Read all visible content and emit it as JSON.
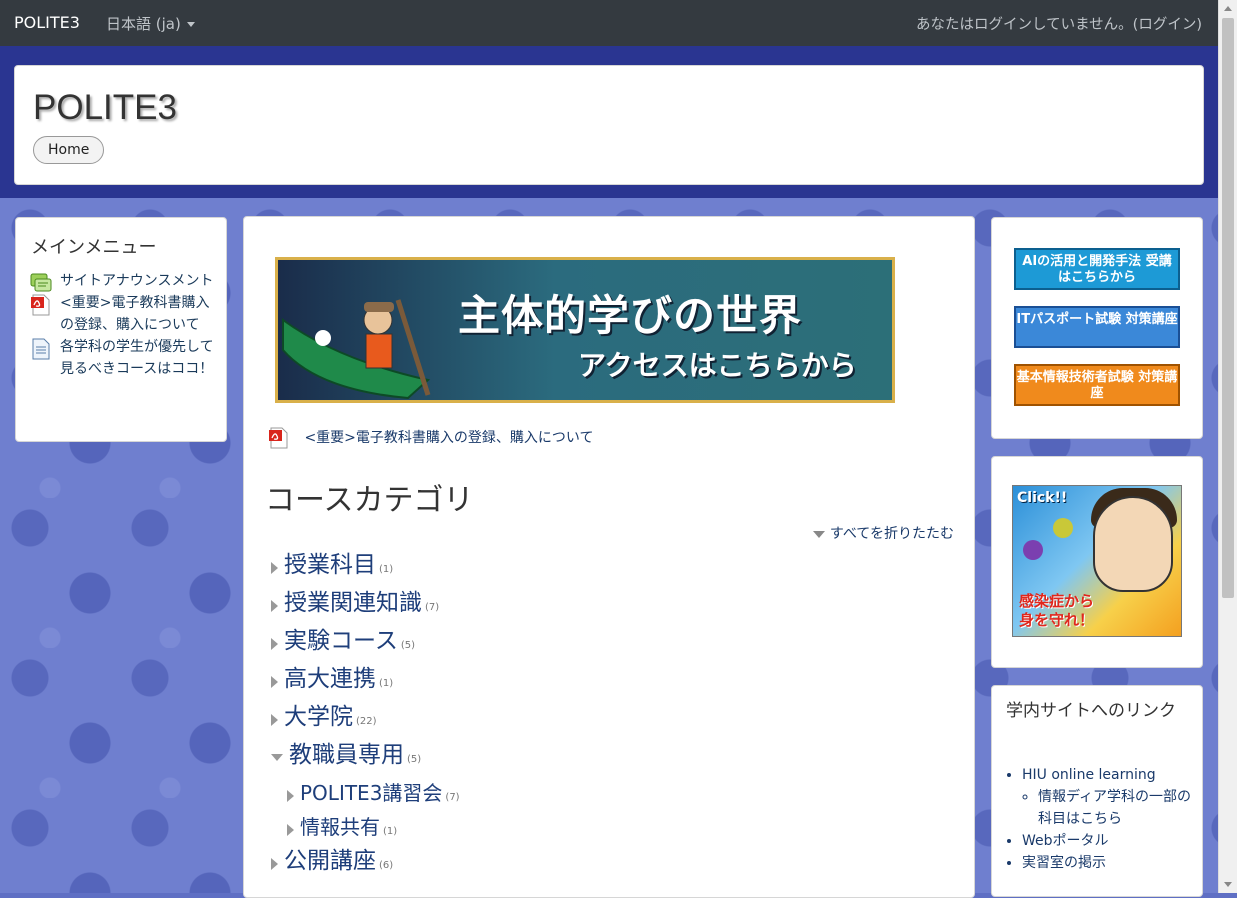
{
  "navbar": {
    "brand": "POLITE3",
    "language": "日本語 (ja)",
    "login_status": "あなたはログインしていません。",
    "login_link": "(ログイン)"
  },
  "header": {
    "site_title": "POLITE3",
    "home_button": "Home"
  },
  "main_menu": {
    "title": "メインメニュー",
    "items": [
      {
        "label": "サイトアナウンスメント",
        "icon": "forum-icon"
      },
      {
        "label": "<重要>電子教科書購入の登録、購入について",
        "icon": "pdf-icon"
      },
      {
        "label": "各学科の学生が優先して見るべきコースはココ！",
        "icon": "page-icon"
      }
    ]
  },
  "main": {
    "banner": {
      "line1": "主体的学びの世界",
      "line2": "アクセスはこちらから"
    },
    "pdf_link": "<重要>電子教科書購入の登録、購入について",
    "categories_title": "コースカテゴリ",
    "collapse_all": "すべてを折りたたむ",
    "categories": [
      {
        "name": "授業科目",
        "count": "(1)",
        "level": 0,
        "open": false
      },
      {
        "name": "授業関連知識",
        "count": "(7)",
        "level": 0,
        "open": false
      },
      {
        "name": "実験コース",
        "count": "(5)",
        "level": 0,
        "open": false
      },
      {
        "name": "高大連携",
        "count": "(1)",
        "level": 0,
        "open": false
      },
      {
        "name": "大学院",
        "count": "(22)",
        "level": 0,
        "open": false
      },
      {
        "name": "教職員専用",
        "count": "(5)",
        "level": 0,
        "open": true
      },
      {
        "name": "POLITE3講習会",
        "count": "(7)",
        "level": 1,
        "open": false
      },
      {
        "name": "情報共有",
        "count": "(1)",
        "level": 1,
        "open": false
      },
      {
        "name": "公開講座",
        "count": "(6)",
        "level": 0,
        "open": false
      }
    ]
  },
  "right_banners": {
    "ai": "AIの活用と開発手法 受講はこちらから",
    "it_passport": "ITパスポート試験 対策講座",
    "fe": "基本情報技術者試験 対策講座"
  },
  "infection_ad": {
    "click": "Click!!",
    "message_line1": "感染症から",
    "message_line2": "身を守れ！"
  },
  "campus_links": {
    "title": "学内サイトへのリンク",
    "hiu_online": "HIU online learning",
    "media_dept": "情報ディア学科の一部の科目はこちら",
    "web_portal": "Webポータル",
    "lab_board": "実習室の掲示"
  }
}
